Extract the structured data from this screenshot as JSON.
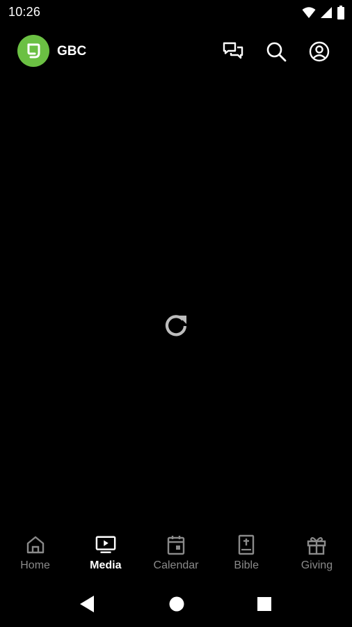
{
  "status_bar": {
    "time": "10:26",
    "icons": [
      "wifi-icon",
      "cell-signal-icon",
      "battery-icon"
    ]
  },
  "app_bar": {
    "title": "GBC",
    "logo_color": "#6bc043",
    "actions": [
      "chat-icon",
      "search-icon",
      "account-icon"
    ]
  },
  "content": {
    "state": "loading",
    "icon": "refresh-icon"
  },
  "bottom_nav": {
    "items": [
      {
        "label": "Home",
        "icon": "home-icon",
        "active": false
      },
      {
        "label": "Media",
        "icon": "tv-play-icon",
        "active": true
      },
      {
        "label": "Calendar",
        "icon": "calendar-icon",
        "active": false
      },
      {
        "label": "Bible",
        "icon": "bible-icon",
        "active": false
      },
      {
        "label": "Giving",
        "icon": "gift-icon",
        "active": false
      }
    ],
    "active_color": "#ffffff",
    "inactive_color": "#8a8a8a"
  },
  "system_nav": {
    "buttons": [
      "back-icon",
      "home-circle-icon",
      "recents-icon"
    ]
  }
}
